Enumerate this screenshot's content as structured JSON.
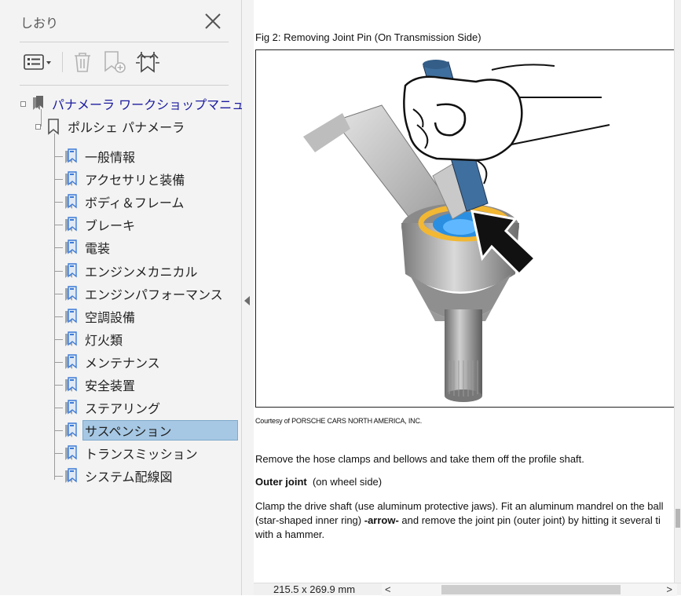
{
  "bookmarks_panel": {
    "title": "しおり",
    "root": "パナメーラ ワークショップマニュアル",
    "child": "ポルシェ パナメーラ",
    "items": [
      "一般情報",
      "アクセサリと装備",
      "ボディ＆フレーム",
      "ブレーキ",
      "電装",
      "エンジンメカニカル",
      "エンジンパフォーマンス",
      "空調設備",
      "灯火類",
      "メンテナンス",
      "安全装置",
      "ステアリング",
      "サスペンション",
      "トランスミッション",
      "システム配線図"
    ],
    "selected_item": "サスペンション"
  },
  "document": {
    "figure_caption": "Fig 2: Removing Joint Pin (On Transmission Side)",
    "courtesy": "Courtesy of PORSCHE CARS NORTH AMERICA, INC.",
    "para1": "Remove the hose clamps and bellows and take them off the profile shaft.",
    "outer_joint_title": "Outer joint",
    "outer_joint_note": "(on wheel side)",
    "para3_line1": "Clamp the drive shaft (use aluminum protective jaws). Fit an aluminum mandrel on the ball",
    "para3_line2_a": "(star-shaped inner ring) ",
    "para3_line2_arrow": "-arrow-",
    "para3_line2_b": "  and remove the joint pin (outer joint) by hitting it several ti",
    "para3_line3": "with a hammer."
  },
  "status": {
    "page_size": "215.5 x 269.9 mm"
  },
  "colors": {
    "selection": "#a6c8e4",
    "bookmark_icon": "#3d7bd6",
    "root_label": "#1b1ba0"
  }
}
